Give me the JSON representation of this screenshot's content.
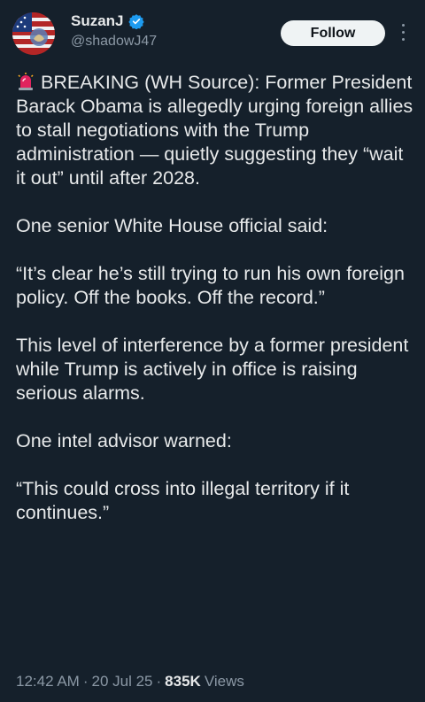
{
  "author": {
    "display_name": "SuzanJ",
    "handle": "@shadowJ47",
    "verified_icon": "verified-badge-icon",
    "verified_color": "#1d9bf0"
  },
  "follow_label": "Follow",
  "tweet": {
    "emoji": "siren-icon",
    "paragraphs": [
      "BREAKING (WH Source): Former President Barack Obama is allegedly urging foreign allies to stall negotiations with the Trump administration — quietly suggesting they “wait it out” until after 2028.",
      "One senior White House official said:",
      "“It’s clear he’s still trying to run his own foreign policy. Off the books. Off the record.”",
      "This level of interference by a former president while Trump is actively in office is raising serious alarms.",
      "One intel advisor warned:",
      "“This could cross into illegal territory if it continues.”"
    ]
  },
  "meta": {
    "time": "12:42 AM",
    "separator": "·",
    "date": "20 Jul 25",
    "views_count": "835K",
    "views_label": "Views"
  },
  "colors": {
    "background": "#15202b",
    "text": "#e7e9ea",
    "secondary": "#8b98a5",
    "follow_bg": "#eff3f4"
  }
}
